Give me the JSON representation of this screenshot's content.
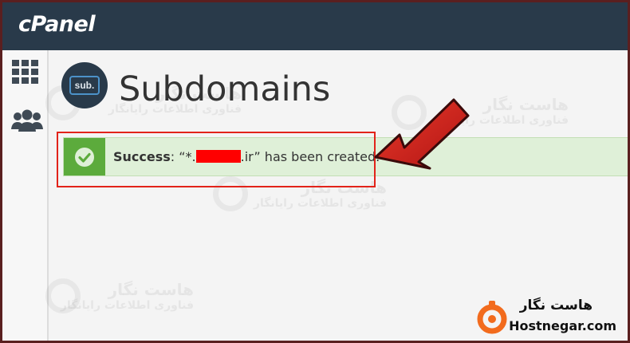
{
  "header": {
    "logo_text": "cPanel"
  },
  "sidebar": {
    "items": [
      {
        "name": "apps-grid-icon"
      },
      {
        "name": "users-icon"
      }
    ]
  },
  "page": {
    "icon_label": "sub.",
    "title": "Subdomains"
  },
  "alert": {
    "type": "success",
    "strong": "Success",
    "text_before": ": “*.",
    "text_after": ".ir” has been created."
  },
  "watermark": {
    "line1": "هاست نگار",
    "line2": "فناوری اطلاعات رایانگار"
  },
  "brand": {
    "name_fa": "هاست نگار",
    "domain": "Hostnegar.com"
  },
  "colors": {
    "topbar": "#293a4a",
    "success_bg": "#dff0d8",
    "success_icon": "#5cab3c",
    "highlight": "#e2231a",
    "arrow": "#d11f1f",
    "brand_orange": "#f26b1d"
  }
}
